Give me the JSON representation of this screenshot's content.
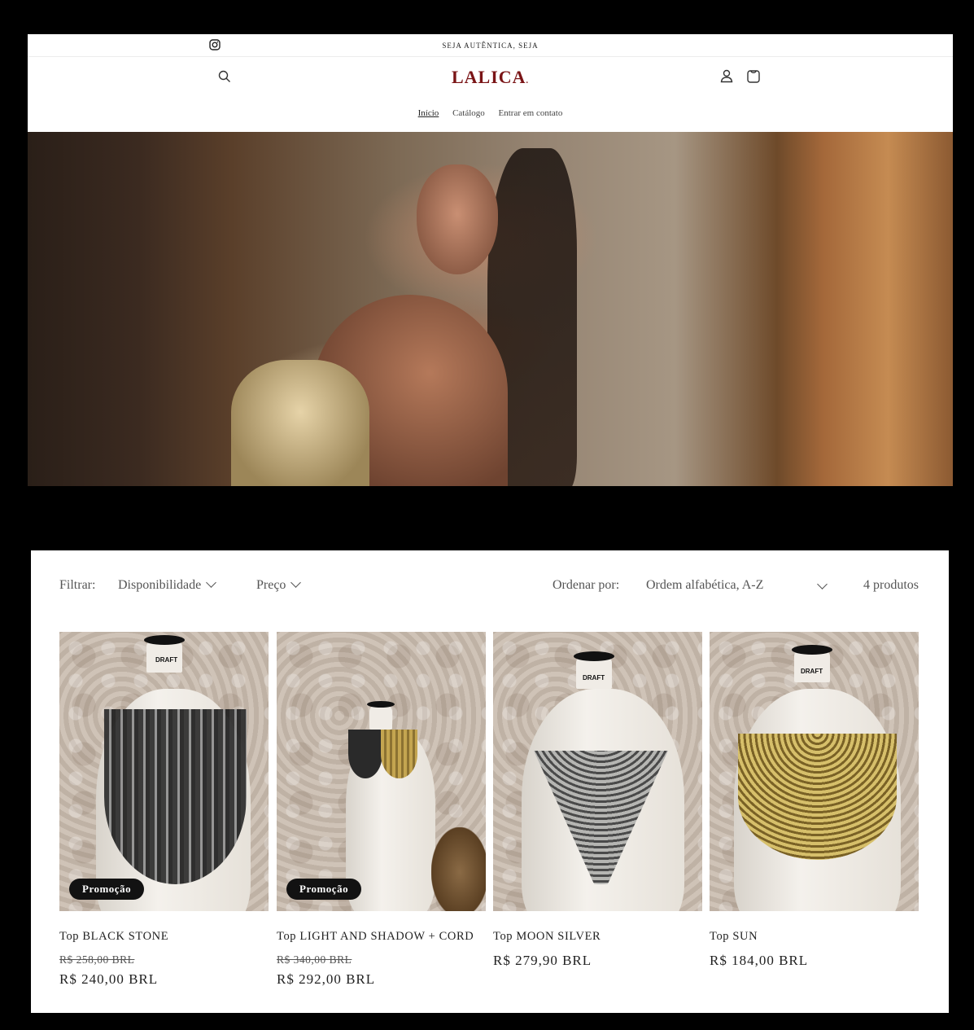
{
  "announcement": "SEJA AUTÊNTICA, SEJA",
  "brand": {
    "logo_text": "LALICA",
    "accent": "#7a1416"
  },
  "header_icons": [
    "instagram-icon",
    "search-icon",
    "account-icon",
    "cart-icon"
  ],
  "nav": {
    "items": [
      {
        "label": "Início",
        "active": true
      },
      {
        "label": "Catálogo",
        "active": false
      },
      {
        "label": "Entrar em contato",
        "active": false
      }
    ]
  },
  "collection": {
    "filter_label": "Filtrar:",
    "filters": [
      "Disponibilidade",
      "Preço"
    ],
    "sort_label": "Ordenar por:",
    "sort_value": "Ordem alfabética, A-Z",
    "count": "4 produtos"
  },
  "products": [
    {
      "title": "Top BLACK STONE",
      "badge": "Promoção",
      "compare_price": "R$ 258,00 BRL",
      "price": "R$ 240,00 BRL",
      "chain_color": "#3a3a3a"
    },
    {
      "title": "Top LIGHT AND SHADOW + CORD",
      "badge": "Promoção",
      "compare_price": "R$ 340,00 BRL",
      "price": "R$ 292,00 BRL",
      "chain_color": "#b49a4a"
    },
    {
      "title": "Top MOON SILVER",
      "badge": "",
      "compare_price": "",
      "price": "R$ 279,90 BRL",
      "chain_color": "#8a8a88"
    },
    {
      "title": "Top SUN",
      "badge": "",
      "compare_price": "",
      "price": "R$ 184,00 BRL",
      "chain_color": "#a8893c"
    }
  ],
  "mannequin_tag": "DRAFT"
}
